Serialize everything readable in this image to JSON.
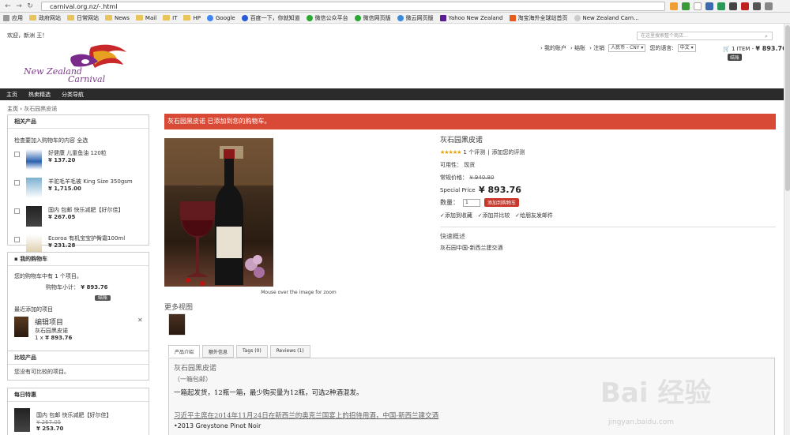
{
  "browser": {
    "url": "carnival.org.nz/-.html",
    "bookmarks": [
      "应用",
      "政府网站",
      "日常网站",
      "News",
      "Mail",
      "IT",
      "HP",
      "Google",
      "百度一下，你就知道",
      "微信公众平台",
      "微信网页版",
      "微云网页版",
      "Yahoo New Zealand",
      "淘宝海外全球站首页",
      "New Zealand Carn..."
    ]
  },
  "header": {
    "welcome": "欢迎，新洲 王！",
    "search_placeholder": "在这里搜索整个商店...",
    "links": [
      "我的账户",
      "结账",
      "注销"
    ],
    "currency": "人民币 - CNY",
    "lang_label": "您的语言:",
    "language": "中文",
    "cart_count": "1 ITEM",
    "cart_total": "¥ 893.76",
    "checkout": "结账"
  },
  "nav": {
    "items": [
      "主页",
      "热卖精选",
      "分类导航"
    ]
  },
  "breadcrumb": {
    "home": "主页",
    "sep": "›",
    "current": "灰石园黑皮诺"
  },
  "related": {
    "title": "相关产品",
    "hint": "检查要加入购物车的内容",
    "select_all": "全选",
    "items": [
      {
        "name": "好健康 儿童鱼油 120粒",
        "price": "¥ 137.20"
      },
      {
        "name": "羊驼毛羊毛被 King Size 350gsm",
        "price": "¥ 1,715.00"
      },
      {
        "name": "国内 包邮 快乐减肥【好尔佳】",
        "price": "¥ 267.05"
      },
      {
        "name": "Ecoroa 有机宝宝护臀霜100ml",
        "price": "¥ 231.28"
      }
    ]
  },
  "mycart": {
    "title": "我的购物车",
    "summary": "您的购物车中有 1 个项目。",
    "subtotal_label": "购物车小计：",
    "subtotal": "¥ 893.76",
    "checkout": "结账",
    "recent_label": "最近添加的项目",
    "item_edit": "编辑项目",
    "item_name": "灰石园黑皮诺",
    "item_qty": "1 x",
    "item_price": "¥ 893.76"
  },
  "compare": {
    "title": "比较产品",
    "empty": "您没有可比较的项目。"
  },
  "daily": {
    "title": "每日特惠",
    "name": "国内 包邮 快乐减肥【好尔佳】",
    "old": "¥ 267.05",
    "price": "¥ 253.70"
  },
  "notice": "灰石园黑皮诺 已添加到您的购物车。",
  "product": {
    "name": "灰石园黑皮诺",
    "stars": "★★★★★",
    "reviews": "1 个评测",
    "add_review": "添加您的评测",
    "availability": "可用性：  现货",
    "regular_label": "常规价格：",
    "regular": "¥ 940.80",
    "special_label": "Special Price",
    "special": "¥ 893.76",
    "qty_label": "数量：",
    "qty": "1",
    "add_to_cart": "添加到购物车",
    "wishlist": "添加到收藏",
    "compare": "添加并比较",
    "email": "给朋友发邮件",
    "quick_title": "快速概述",
    "quick_text": "灰石园中国-新西兰建交酒",
    "zoom_caption": "Mouse over the image for zoom",
    "more_views": "更多视图"
  },
  "tabs": [
    "产品介绍",
    "额外信息",
    "Tags (0)",
    "Reviews (1)"
  ],
  "description": {
    "line1": "灰石园黑皮诺",
    "line2": "（一箱包邮）",
    "line3": "一箱起发货，12瓶一箱，最少购买量为12瓶，可选2种酒混发。",
    "line4": "习近平主席在2014年11月24日在新西兰的奥克兰国宴上的招待用酒，中国-新西兰建交酒",
    "line5": "•2013 Greystone Pinot Noir"
  },
  "watermark": {
    "main": "Bai 经验",
    "sub": "jingyan.baidu.com"
  },
  "colors": {
    "accent_red": "#d94a36",
    "nav_bg": "#2b2b2b"
  }
}
